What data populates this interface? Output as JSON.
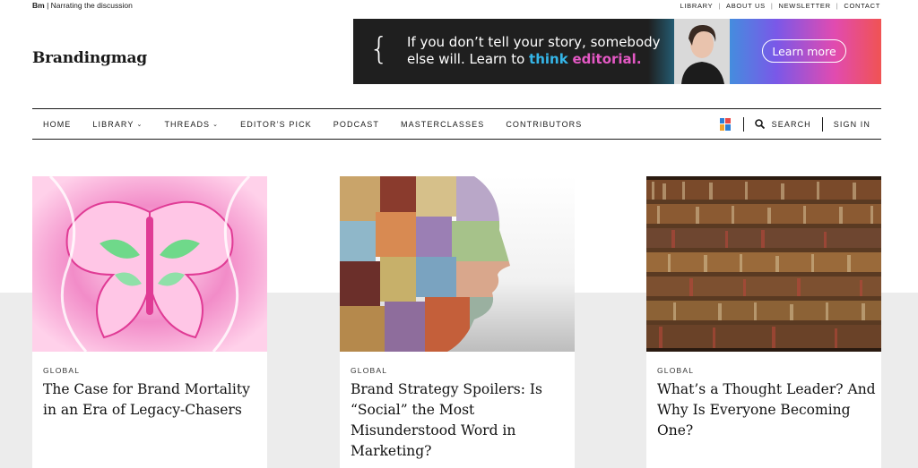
{
  "topbar": {
    "brand_short": "Bm",
    "tagline": "| Narrating the discussion",
    "links": [
      "LIBRARY",
      "ABOUT US",
      "NEWSLETTER",
      "CONTACT"
    ]
  },
  "logo": "Brandingmag",
  "ad": {
    "line1": "If you don’t tell your story, somebody",
    "line2_prefix": "else will. Learn to ",
    "highlight1": "think",
    "highlight2": "editorial.",
    "button": "Learn more"
  },
  "nav": {
    "items": [
      "HOME",
      "LIBRARY",
      "THREADS",
      "EDITOR’S PICK",
      "PODCAST",
      "MASTERCLASSES",
      "CONTRIBUTORS"
    ],
    "search": "SEARCH",
    "signin": "SIGN IN"
  },
  "cards": [
    {
      "category": "GLOBAL",
      "title": "The Case for Brand Mortality in an Era of Legacy-Chasers"
    },
    {
      "category": "GLOBAL",
      "title": "Brand Strategy Spoilers: Is “Social” the Most Misunderstood Word in Marketing?"
    },
    {
      "category": "GLOBAL",
      "title": "What’s a Thought Leader? And Why Is Everyone Becoming One?"
    }
  ],
  "colors": {
    "accent_blue": "#35b6e8",
    "accent_pink": "#e458c4",
    "grey_band": "#ececec"
  }
}
